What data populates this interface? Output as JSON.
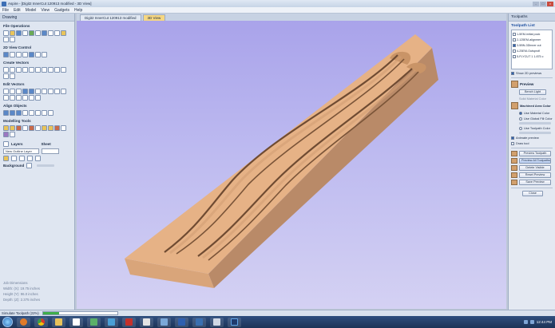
{
  "window": {
    "title": "Aspire - [Digit2 InnerCut 120913 modified - 3D View]",
    "controls": [
      "-",
      "□",
      "×"
    ]
  },
  "menu": {
    "items": [
      "File",
      "Edit",
      "Model",
      "View",
      "Gadgets",
      "Help"
    ]
  },
  "left_panel": {
    "tab": "Drawing",
    "sections": [
      {
        "title": "File Operations"
      },
      {
        "title": "2D View Control"
      },
      {
        "title": "Create Vectors"
      },
      {
        "title": "Edit Vectors"
      },
      {
        "title": "Align Objects"
      },
      {
        "title": "Modelling Tools"
      }
    ],
    "layers": {
      "label": "Layers",
      "sheet_label": "Sheet",
      "current_layer": "New Outline Layer"
    },
    "background_label": "Background",
    "job_dimensions": {
      "title": "Job Dimensions",
      "width": "Width: (X): 19.75 inches",
      "height": "Height (Y): 96.0 inches",
      "depth": "Depth: (Z): 2.375 inches"
    }
  },
  "view_tabs": [
    "Digit2 InnerCut 120913 modified",
    "3D View"
  ],
  "right_panel": {
    "tab": "Toolpaths",
    "toolpath_list_title": "Toolpath List",
    "toolpaths": [
      "1-5EM-initial pock",
      "2-125EM-alignmer",
      "3-5BN-3Dinner cut",
      "4-25EM-Outsprofi",
      "5-FLYCUT 1 1.875 c"
    ],
    "show_2d_previews": "Show 2D previews",
    "preview_title": "Preview",
    "reset_light_btn": "Bench Light",
    "solid_material_label": "Solid Material Color",
    "machined_area_title": "Machined Area Color",
    "radio_options": [
      "Use Material Color",
      "Use Global Fill Color",
      "Use Toolpath Color"
    ],
    "animate_preview": "Animate preview",
    "draw_tool": "Draw tool",
    "buttons": [
      "Preview Toolpath",
      "Preview All Toolpaths",
      "Delete Visible",
      "Reset Preview",
      "Save Preview"
    ],
    "close_btn": "Close"
  },
  "status": {
    "text": "Simulate Toolpath (22%)",
    "progress": 0.22
  },
  "taskbar": {
    "icons": [
      "start-orb-icon",
      "firefox-icon",
      "chrome-icon",
      "explorer-icon",
      "media-icon",
      "photo-icon",
      "viewer-icon",
      "filezilla-icon",
      "pdf-icon",
      "app-icon",
      "word-icon",
      "vectric-icon",
      "mail-icon",
      "photoshop-icon"
    ],
    "clock": "12:44 PM"
  },
  "colors": {
    "wood_top": "#e6b286",
    "wood_side": "#b98a68",
    "wood_front": "#d9a57a",
    "viewport_top": "#a9a3ea",
    "viewport_bottom": "#d4d1f3"
  }
}
